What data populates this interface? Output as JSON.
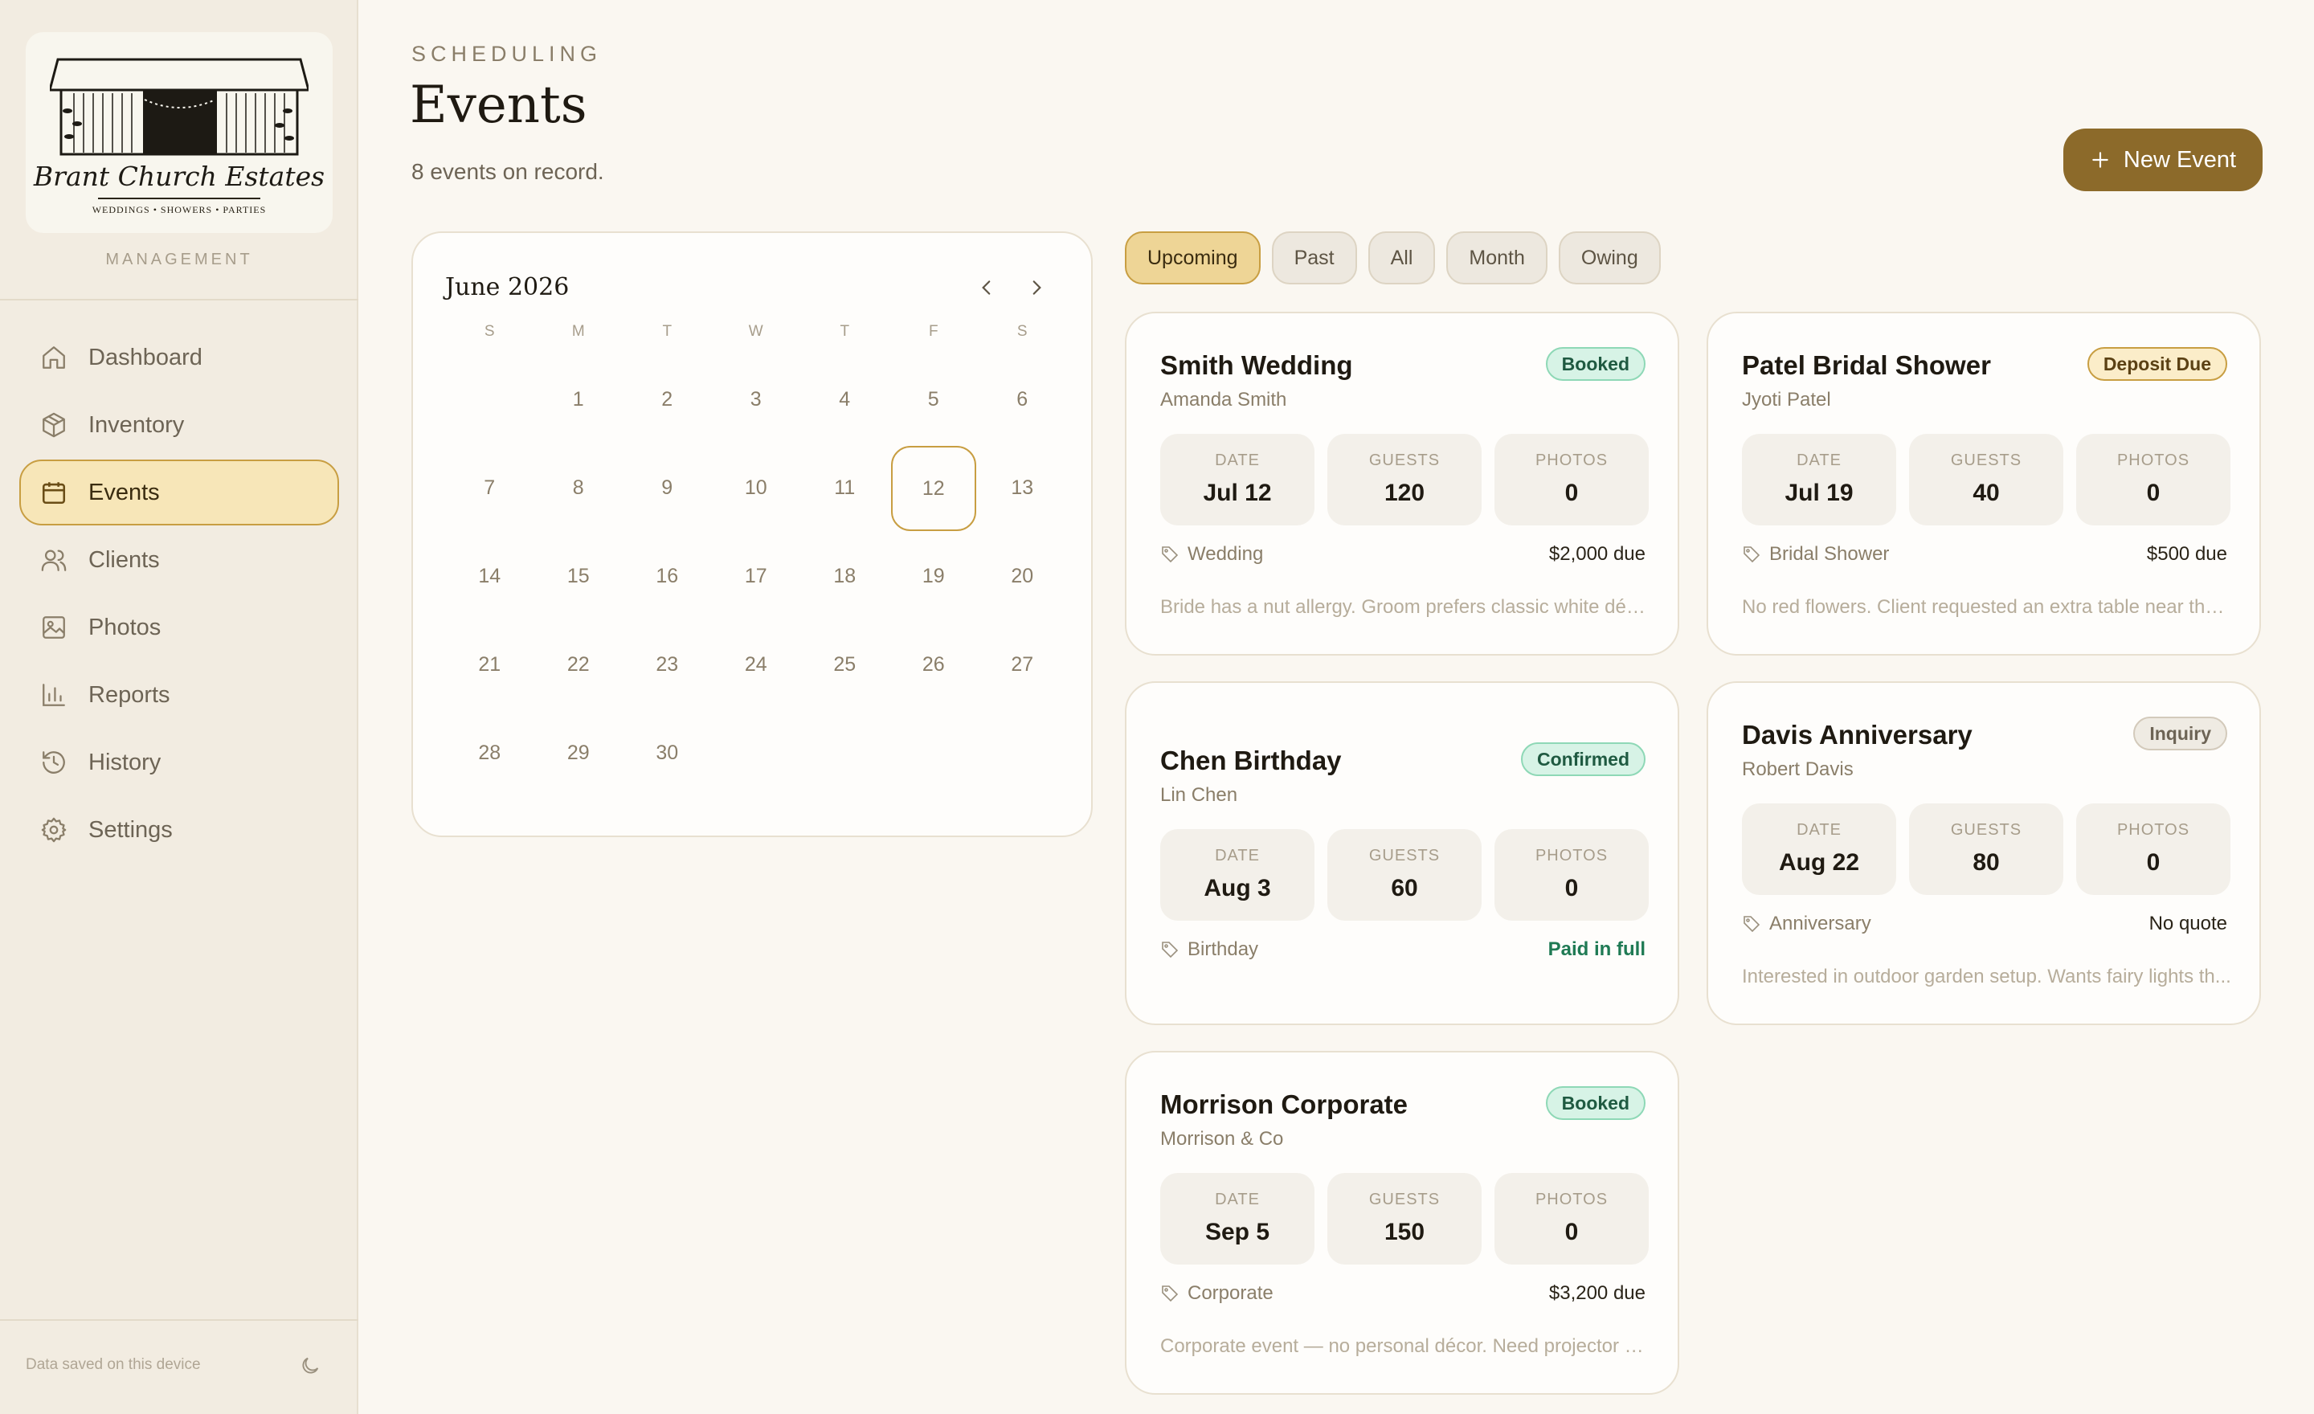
{
  "brand": {
    "name": "Brant Church Estates",
    "tagline": "WEDDINGS • SHOWERS • PARTIES",
    "section_label": "MANAGEMENT"
  },
  "sidebar": {
    "items": [
      {
        "label": "Dashboard",
        "icon": "home-icon"
      },
      {
        "label": "Inventory",
        "icon": "box-icon"
      },
      {
        "label": "Events",
        "icon": "calendar-icon",
        "active": true
      },
      {
        "label": "Clients",
        "icon": "users-icon"
      },
      {
        "label": "Photos",
        "icon": "image-icon"
      },
      {
        "label": "Reports",
        "icon": "bar-chart-icon"
      },
      {
        "label": "History",
        "icon": "history-icon"
      },
      {
        "label": "Settings",
        "icon": "gear-icon"
      }
    ],
    "footer_text": "Data saved on this device"
  },
  "header": {
    "eyebrow": "SCHEDULING",
    "title": "Events",
    "subtitle": "8 events on record.",
    "new_button_label": "New Event"
  },
  "calendar": {
    "month_label": "June 2026",
    "weekdays": [
      "S",
      "M",
      "T",
      "W",
      "T",
      "F",
      "S"
    ],
    "weeks": [
      [
        "",
        "1",
        "2",
        "3",
        "4",
        "5",
        "6"
      ],
      [
        "7",
        "8",
        "9",
        "10",
        "11",
        "12",
        "13"
      ],
      [
        "14",
        "15",
        "16",
        "17",
        "18",
        "19",
        "20"
      ],
      [
        "21",
        "22",
        "23",
        "24",
        "25",
        "26",
        "27"
      ],
      [
        "28",
        "29",
        "30",
        "",
        "",
        "",
        ""
      ]
    ],
    "today": "12"
  },
  "filters": [
    {
      "label": "Upcoming",
      "active": true
    },
    {
      "label": "Past"
    },
    {
      "label": "All"
    },
    {
      "label": "Month"
    },
    {
      "label": "Owing"
    }
  ],
  "stat_labels": {
    "date": "DATE",
    "guests": "GUESTS",
    "photos": "PHOTOS"
  },
  "events": [
    {
      "title": "Smith Wedding",
      "client": "Amanda Smith",
      "status": "Booked",
      "date": "Jul 12",
      "guests": "120",
      "photos": "0",
      "type": "Wedding",
      "balance": "$2,000 due",
      "note": "Bride has a nut allergy. Groom prefers classic white déco..."
    },
    {
      "title": "Patel Bridal Shower",
      "client": "Jyoti Patel",
      "status": "Deposit Due",
      "date": "Jul 19",
      "guests": "40",
      "photos": "0",
      "type": "Bridal Shower",
      "balance": "$500 due",
      "note": "No red flowers. Client requested an extra table near the ..."
    },
    {
      "title": "Chen Birthday",
      "client": "Lin Chen",
      "status": "Confirmed",
      "date": "Aug 3",
      "guests": "60",
      "photos": "0",
      "type": "Birthday",
      "balance": "Paid in full",
      "note": ""
    },
    {
      "title": "Davis Anniversary",
      "client": "Robert Davis",
      "status": "Inquiry",
      "date": "Aug 22",
      "guests": "80",
      "photos": "0",
      "type": "Anniversary",
      "balance": "No quote",
      "note": "Interested in outdoor garden setup. Wants fairy lights th..."
    },
    {
      "title": "Morrison Corporate",
      "client": "Morrison & Co",
      "status": "Booked",
      "date": "Sep 5",
      "guests": "150",
      "photos": "0",
      "type": "Corporate",
      "balance": "$3,200 due",
      "note": "Corporate event — no personal décor. Need projector an..."
    }
  ],
  "colors": {
    "accent": "#8c6a2a",
    "active_fill": "#f7e6b8",
    "booked_green": "#1f5a41",
    "paid_green": "#1f7a54"
  }
}
